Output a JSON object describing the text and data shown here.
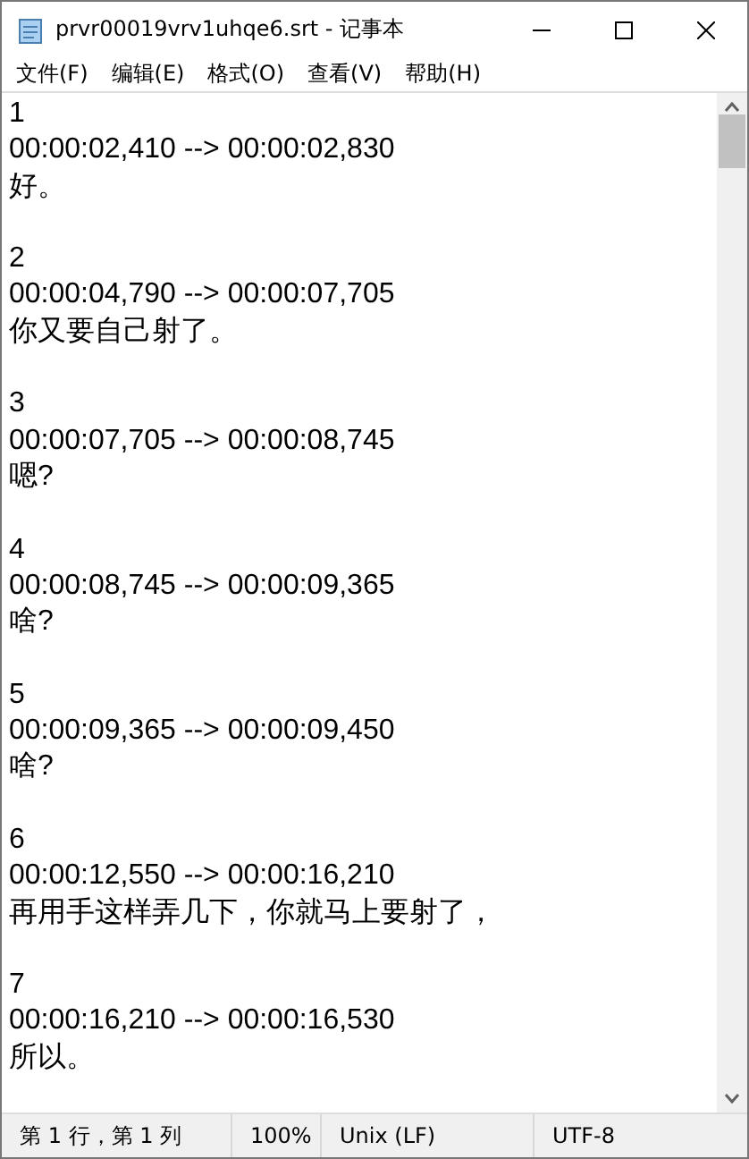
{
  "window": {
    "title": "prvr00019vrv1uhqe6.srt - 记事本"
  },
  "menu": [
    "文件(F)",
    "编辑(E)",
    "格式(O)",
    "查看(V)",
    "帮助(H)"
  ],
  "subtitles": [
    {
      "index": "1",
      "time": "00:00:02,410 --> 00:00:02,830",
      "text": "好。"
    },
    {
      "index": "2",
      "time": "00:00:04,790 --> 00:00:07,705",
      "text": "你又要自己射了。"
    },
    {
      "index": "3",
      "time": "00:00:07,705 --> 00:00:08,745",
      "text": "嗯?"
    },
    {
      "index": "4",
      "time": "00:00:08,745 --> 00:00:09,365",
      "text": "啥?"
    },
    {
      "index": "5",
      "time": "00:00:09,365 --> 00:00:09,450",
      "text": "啥?"
    },
    {
      "index": "6",
      "time": "00:00:12,550 --> 00:00:16,210",
      "text": "再用手这样弄几下，你就马上要射了，"
    },
    {
      "index": "7",
      "time": "00:00:16,210 --> 00:00:16,530",
      "text": "所以。"
    }
  ],
  "status_bar": [
    "第 1 行，第 1 列",
    "100%",
    "Unix (LF)",
    "UTF-8"
  ]
}
